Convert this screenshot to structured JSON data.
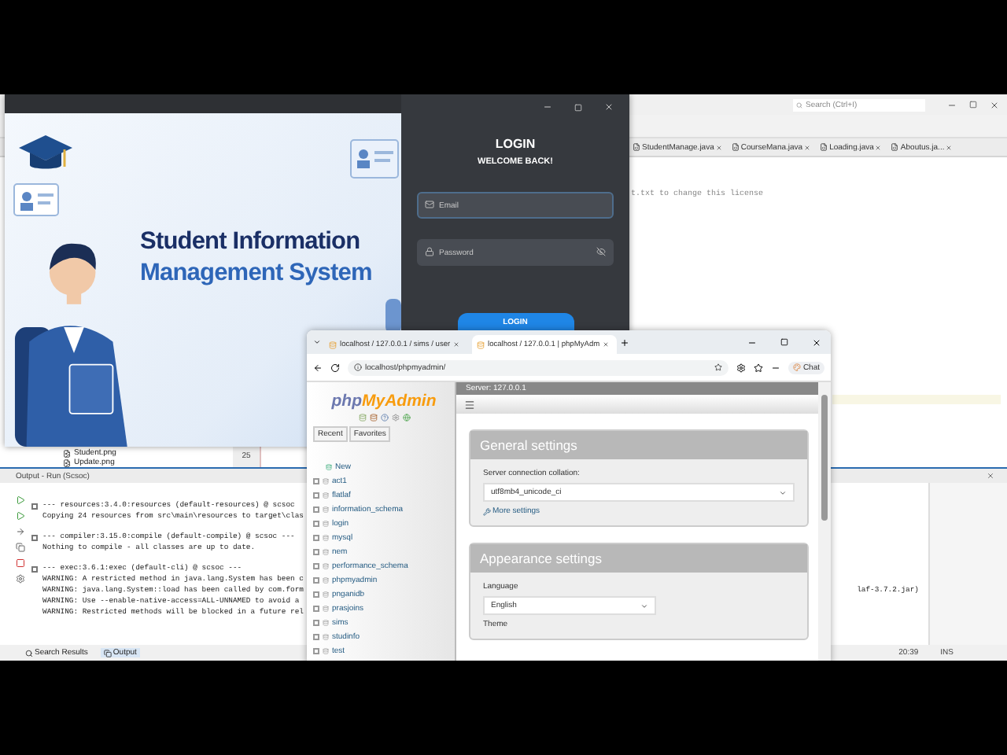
{
  "ide": {
    "search": {
      "placeholder": "Search (Ctrl+I)"
    },
    "editor_tabs": [
      {
        "label": "StudentManage.java"
      },
      {
        "label": "CourseMana.java"
      },
      {
        "label": "Loading.java"
      },
      {
        "label": "Aboutus.ja..."
      }
    ],
    "code_line": "t.txt to change this license",
    "files": [
      "Student.png",
      "Update.png"
    ],
    "line_number": "25",
    "output": {
      "title": "Output - Run (Scsoc)",
      "lines": [
        {
          "kind": "fold",
          "text": "--- resources:3.4.0:resources (default-resources) @ scsoc"
        },
        {
          "kind": "text",
          "text": "Copying 24 resources from src\\main\\resources to target\\clas"
        },
        {
          "kind": "fold",
          "text": "--- compiler:3.15.0:compile (default-compile) @ scsoc ---"
        },
        {
          "kind": "text",
          "text": "Nothing to compile - all classes are up to date."
        },
        {
          "kind": "fold",
          "text": "--- exec:3.6.1:exec (default-cli) @ scsoc ---"
        },
        {
          "kind": "text",
          "text": "WARNING: A restricted method in java.lang.System has been c"
        },
        {
          "kind": "text",
          "text": "WARNING: java.lang.System::load has been called by com.form",
          "tail": "laf-3.7.2.jar)"
        },
        {
          "kind": "text",
          "text": "WARNING: Use --enable-native-access=ALL-UNNAMED to avoid a"
        },
        {
          "kind": "text",
          "text": "WARNING: Restricted methods will be blocked in a future rel"
        }
      ]
    },
    "bottom_tabs": [
      {
        "label": "Search Results",
        "selected": false
      },
      {
        "label": "Output",
        "selected": true
      }
    ],
    "status": {
      "position": "20:39",
      "mode": "INS"
    }
  },
  "login_window": {
    "banner": {
      "line1": "Student Information",
      "line2": "Management System"
    },
    "title": "LOGIN",
    "subtitle": "WELCOME BACK!",
    "email": {
      "placeholder": "Email"
    },
    "password": {
      "placeholder": "Password"
    },
    "button": "LOGIN"
  },
  "browser": {
    "tabs": [
      {
        "label": "localhost / 127.0.0.1 / sims / user",
        "selected": false
      },
      {
        "label": "localhost / 127.0.0.1 | phpMyAdm",
        "selected": true
      }
    ],
    "address": "localhost/phpmyadmin/",
    "chat": "Chat",
    "pma": {
      "logo": [
        "php",
        "MyAdmin"
      ],
      "nav_buttons": [
        "Recent",
        "Favorites"
      ],
      "databases": [
        {
          "kind": "new",
          "name": "New"
        },
        {
          "kind": "db",
          "name": "act1"
        },
        {
          "kind": "db",
          "name": "flatlaf"
        },
        {
          "kind": "db",
          "name": "information_schema"
        },
        {
          "kind": "db",
          "name": "login"
        },
        {
          "kind": "db",
          "name": "mysql"
        },
        {
          "kind": "db",
          "name": "nem"
        },
        {
          "kind": "db",
          "name": "performance_schema"
        },
        {
          "kind": "db",
          "name": "phpmyadmin"
        },
        {
          "kind": "db",
          "name": "pnganidb"
        },
        {
          "kind": "db",
          "name": "prasjoins"
        },
        {
          "kind": "db",
          "name": "sims"
        },
        {
          "kind": "db",
          "name": "studinfo"
        },
        {
          "kind": "db",
          "name": "test"
        }
      ],
      "server": "Server: 127.0.0.1",
      "general": {
        "title": "General settings",
        "collation_label": "Server connection collation:",
        "collation": "utf8mb4_unicode_ci",
        "more": "More settings"
      },
      "appearance": {
        "title": "Appearance settings",
        "language_label": "Language",
        "language": "English",
        "theme_label": "Theme"
      }
    }
  }
}
